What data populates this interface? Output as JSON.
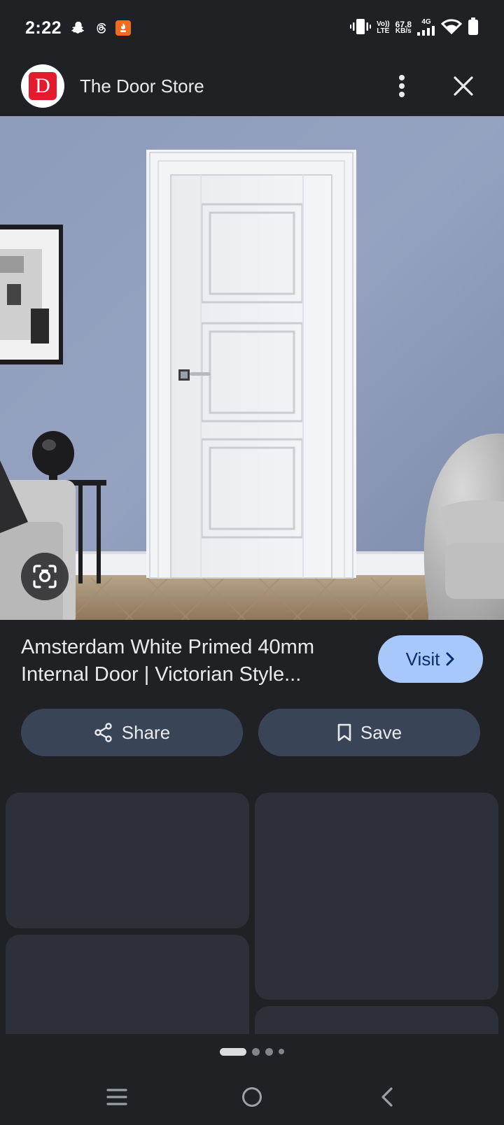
{
  "status_bar": {
    "time": "2:22",
    "network_rate": "67.8",
    "network_unit": "KB/s",
    "volte_top": "Vo))",
    "volte_bottom": "LTE",
    "network_type": "4G"
  },
  "header": {
    "site_name": "The Door Store",
    "brand_initial": "D"
  },
  "result": {
    "title": "Amsterdam White Primed 40mm Internal Door | Victorian Style...",
    "visit_label": "Visit"
  },
  "actions": {
    "share_label": "Share",
    "save_label": "Save"
  },
  "colors": {
    "background": "#202124",
    "visit_button": "#a8c7fa",
    "action_button": "#394457",
    "brand_red": "#e21b2d"
  },
  "icons": [
    "snapchat-icon",
    "threads-icon",
    "app-notification-icon",
    "vibrate-icon",
    "signal-icon",
    "wifi-icon",
    "battery-icon",
    "more-vert-icon",
    "close-icon",
    "google-lens-icon",
    "chevron-right-icon",
    "share-icon",
    "bookmark-icon",
    "menu-icon",
    "home-icon",
    "back-icon"
  ]
}
